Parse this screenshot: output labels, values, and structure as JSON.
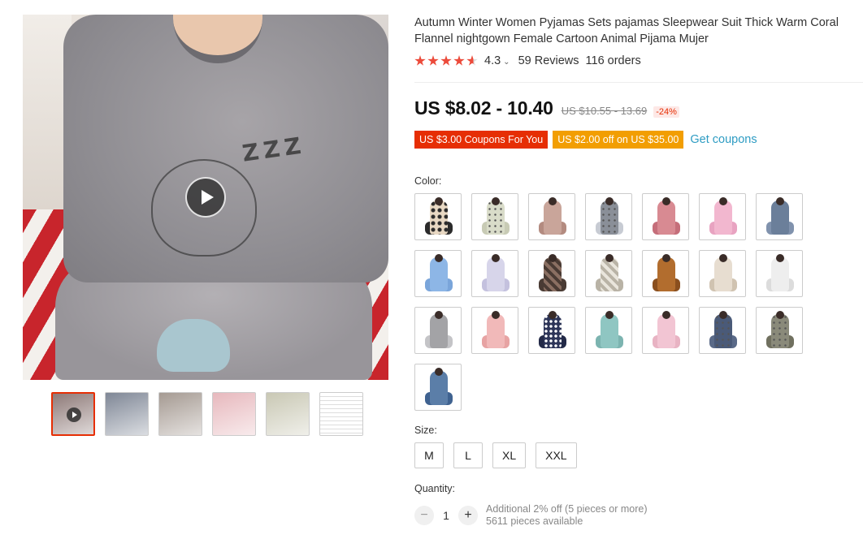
{
  "product": {
    "title": "Autumn Winter Women Pyjamas Sets pajamas Sleepwear Suit Thick Warm Coral Flannel nightgown Female Cartoon Animal Pijama Mujer",
    "rating": "4.3",
    "rating_chevron": "⌄",
    "reviews": "59 Reviews",
    "orders": "116 orders",
    "stars": {
      "full": 4,
      "partial": 0.5
    }
  },
  "price": {
    "current": "US $8.02 - 10.40",
    "original": "US $10.55 - 13.69",
    "discount": "-24%"
  },
  "coupons": {
    "store_coupon": "US $3.00 Coupons For You",
    "select_coupon": "US $2.00 off on US $35.00",
    "get_coupons": "Get coupons"
  },
  "color": {
    "label": "Color:",
    "options": [
      {
        "name": "color-option-1",
        "top": "#e8d8c3",
        "legs": "#2b2b2b",
        "pattern": "leopard"
      },
      {
        "name": "color-option-2",
        "top": "#d9dcc9",
        "legs": "#c8cbb5",
        "pattern": "print"
      },
      {
        "name": "color-option-3",
        "top": "#c9a59a",
        "legs": "#b38b80",
        "pattern": "plain"
      },
      {
        "name": "color-option-4",
        "top": "#8a8f98",
        "legs": "#c7cbd3",
        "pattern": "print"
      },
      {
        "name": "color-option-5",
        "top": "#d88a92",
        "legs": "#c56e7a",
        "pattern": "plain"
      },
      {
        "name": "color-option-6",
        "top": "#f2b7cf",
        "legs": "#e8a3c1",
        "pattern": "plain"
      },
      {
        "name": "color-option-7",
        "top": "#6b7f9a",
        "legs": "#8092ad",
        "pattern": "plain"
      },
      {
        "name": "color-option-8",
        "top": "#8db6e6",
        "legs": "#7aa5da",
        "pattern": "plain"
      },
      {
        "name": "color-option-9",
        "top": "#d7d5ea",
        "legs": "#c4c1de",
        "pattern": "plain"
      },
      {
        "name": "color-option-10",
        "top": "#8a6f62",
        "legs": "#4a3b34",
        "pattern": "stripe"
      },
      {
        "name": "color-option-11",
        "top": "#e9e5dc",
        "legs": "#b9b3a6",
        "pattern": "stripe"
      },
      {
        "name": "color-option-12",
        "top": "#b26d2e",
        "legs": "#8a4f1e",
        "pattern": "bear"
      },
      {
        "name": "color-option-13",
        "top": "#e7ddd0",
        "legs": "#d0c3b1",
        "pattern": "bear"
      },
      {
        "name": "color-option-14",
        "top": "#eeeeee",
        "legs": "#dcdcdc",
        "pattern": "plain"
      },
      {
        "name": "color-option-15",
        "top": "#a3a3a6",
        "legs": "#c4c4c7",
        "pattern": "plain"
      },
      {
        "name": "color-option-16",
        "top": "#f1b9b9",
        "legs": "#e7a3a3",
        "pattern": "plain"
      },
      {
        "name": "color-option-17",
        "top": "#2d3558",
        "legs": "#232a48",
        "pattern": "dots"
      },
      {
        "name": "color-option-18",
        "top": "#8fc6c2",
        "legs": "#7cb4b0",
        "pattern": "plain"
      },
      {
        "name": "color-option-19",
        "top": "#f2c5d3",
        "legs": "#e8b3c3",
        "pattern": "plain"
      },
      {
        "name": "color-option-20",
        "top": "#4a5a78",
        "legs": "#5a6a88",
        "pattern": "print"
      },
      {
        "name": "color-option-21",
        "top": "#8a8a7a",
        "legs": "#70705f",
        "pattern": "print"
      },
      {
        "name": "color-option-22",
        "top": "#5b7ea8",
        "legs": "#3f6290",
        "pattern": "plain"
      }
    ]
  },
  "size": {
    "label": "Size:",
    "options": [
      "M",
      "L",
      "XL",
      "XXL"
    ]
  },
  "quantity": {
    "label": "Quantity:",
    "minus": "−",
    "plus": "+",
    "value": "1",
    "bulk_note": "Additional 2% off (5 pieces or more)",
    "available": "5611 pieces available"
  },
  "gallery": {
    "zzz": "Z Z Z",
    "thumbnails": [
      {
        "name": "thumbnail-1",
        "color": "#8e7a78",
        "video": true
      },
      {
        "name": "thumbnail-2",
        "color": "#7f8796",
        "video": false
      },
      {
        "name": "thumbnail-3",
        "color": "#a59a92",
        "video": false
      },
      {
        "name": "thumbnail-4",
        "color": "#e7b8bd",
        "video": false
      },
      {
        "name": "thumbnail-5",
        "color": "#c9c8b4",
        "video": false
      },
      {
        "name": "thumbnail-6",
        "color": "#f4f4f4",
        "video": false
      }
    ]
  },
  "colors": {
    "accent_red": "#e62e04",
    "coupon_orange": "#f29e02",
    "link_blue": "#2e9cc3",
    "star_red": "#ec4b3b"
  }
}
